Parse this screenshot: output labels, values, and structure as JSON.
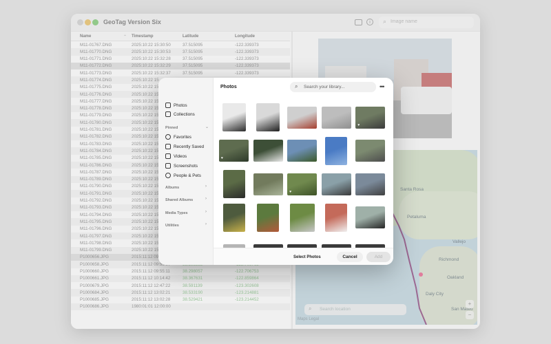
{
  "window": {
    "title": "GeoTag Version Six",
    "search_placeholder": "Image name"
  },
  "table": {
    "headers": [
      "Name",
      "Timestamp",
      "Latitude",
      "Longitude"
    ],
    "rows": [
      [
        "M11-01767.DNG",
        "2025:10:22 15:30:50",
        "37.515095",
        "-122.339373"
      ],
      [
        "M11-01770.DNG",
        "2025:10:22 15:30:53",
        "37.515095",
        "-122.339373"
      ],
      [
        "M11-01771.DNG",
        "2025:10:22 15:32:28",
        "37.515095",
        "-122.339373"
      ],
      [
        "M11-01772.DNG",
        "2025:10:22 15:32:29",
        "37.515095",
        "-122.339373"
      ],
      [
        "M11-01773.DNG",
        "2025:10:22 15:32:37",
        "37.515095",
        "-122.339373"
      ],
      [
        "M11-01774.DNG",
        "2025:10:22 15",
        "",
        ""
      ],
      [
        "M11-01775.DNG",
        "2025:10:22 15",
        "",
        ""
      ],
      [
        "M11-01776.DNG",
        "2025:10:22 15",
        "",
        ""
      ],
      [
        "M11-01777.DNG",
        "2025:10:22 15",
        "",
        ""
      ],
      [
        "M11-01778.DNG",
        "2025:10:22 15",
        "",
        ""
      ],
      [
        "M11-01779.DNG",
        "2025:10:22 15",
        "",
        ""
      ],
      [
        "M11-01780.DNG",
        "2025:10:22 15",
        "",
        ""
      ],
      [
        "M11-01781.DNG",
        "2025:10:22 15",
        "",
        ""
      ],
      [
        "M11-01782.DNG",
        "2025:10:22 15",
        "",
        ""
      ],
      [
        "M11-01783.DNG",
        "2025:10:22 15",
        "",
        ""
      ],
      [
        "M11-01784.DNG",
        "2025:10:22 15",
        "",
        ""
      ],
      [
        "M11-01785.DNG",
        "2025:10:22 15",
        "",
        ""
      ],
      [
        "M11-01786.DNG",
        "2025:10:22 15",
        "",
        ""
      ],
      [
        "M11-01787.DNG",
        "2025:10:22 15",
        "",
        ""
      ],
      [
        "M11-01789.DNG",
        "2025:10:22 15",
        "",
        ""
      ],
      [
        "M11-01790.DNG",
        "2025:10:22 15",
        "",
        ""
      ],
      [
        "M11-01791.DNG",
        "2025:10:22 15",
        "",
        ""
      ],
      [
        "M11-01792.DNG",
        "2025:10:22 15",
        "",
        ""
      ],
      [
        "M11-01793.DNG",
        "2025:10:22 15",
        "",
        ""
      ],
      [
        "M11-01794.DNG",
        "2025:10:22 15",
        "",
        ""
      ],
      [
        "M11-01795.DNG",
        "2025:10:22 15",
        "",
        ""
      ],
      [
        "M11-01796.DNG",
        "2025:10:22 15",
        "",
        ""
      ],
      [
        "M11-01797.DNG",
        "2025:10:22 15",
        "",
        ""
      ],
      [
        "M11-01798.DNG",
        "2025:10:22 15",
        "",
        ""
      ],
      [
        "M11-01799.DNG",
        "2025:10:22 15",
        "",
        ""
      ],
      [
        "P1000656.JPG",
        "2015:11:12 09:52:20",
        "37.765649",
        "-122.475643"
      ],
      [
        "P1000658.JPG",
        "2015:11:12 09:55:07",
        "38.295535",
        "-122.709765"
      ],
      [
        "P1000660.JPG",
        "2015:11:12 09:55:11",
        "38.298057",
        "-122.706753"
      ],
      [
        "P1000661.JPG",
        "2015:11:12 10:14:42",
        "38.367631",
        "-122.859864"
      ],
      [
        "P1000679.JPG",
        "2015:11:12 12:47:22",
        "38.591139",
        "-123.302608"
      ],
      [
        "P1000684.JPG",
        "2015:11:12 13:02:21",
        "38.533190",
        "-123.214881"
      ],
      [
        "P1000685.JPG",
        "2015:11:12 13:02:28",
        "38.529421",
        "-123.214452"
      ],
      [
        "P1000686.JPG",
        "1980:01:01 12:00:00",
        "",
        ""
      ]
    ]
  },
  "map": {
    "labels": [
      "Santa Rosa",
      "Petaluma",
      "Vallejo",
      "Richmond",
      "Oakland",
      "Daly City",
      "San Mateo"
    ],
    "search_placeholder": "Search location",
    "attribution": "Maps",
    "legal": "Legal",
    "zoom_in": "+",
    "zoom_out": "−"
  },
  "picker": {
    "title": "Photos",
    "search_placeholder": "Search your library...",
    "more": "•••",
    "sidebar": {
      "top": [
        {
          "label": "Photos",
          "icon": "photos-icon"
        },
        {
          "label": "Collections",
          "icon": "collections-icon"
        }
      ],
      "pinned_label": "Pinned",
      "pinned": [
        {
          "label": "Favorites",
          "icon": "heart-icon"
        },
        {
          "label": "Recently Saved",
          "icon": "recently-saved-icon"
        },
        {
          "label": "Videos",
          "icon": "video-icon"
        },
        {
          "label": "Screenshots",
          "icon": "screenshot-icon"
        },
        {
          "label": "People & Pets",
          "icon": "people-icon"
        }
      ],
      "sections": [
        "Albums",
        "Shared Albums",
        "Media Types",
        "Utilities"
      ]
    },
    "footer_label": "Select Photos",
    "cancel": "Cancel",
    "add": "Add",
    "favorite_glyph": "♥",
    "thumbs": [
      {
        "colors": [
          "#e9e9e9",
          "#2b2b2b"
        ],
        "fav": false
      },
      {
        "colors": [
          "#d9d9d9",
          "#1f1f1f"
        ],
        "fav": false
      },
      {
        "colors": [
          "#cfcfcf",
          "#a53e2e"
        ],
        "fav": false
      },
      {
        "colors": [
          "#bdbdbd",
          "#8f8f8f"
        ],
        "fav": false
      },
      {
        "colors": [
          "#6f7b62",
          "#3b3b3b"
        ],
        "fav": true
      },
      {
        "colors": [
          "#5e6c4f",
          "#2e3a2a"
        ],
        "fav": true
      },
      {
        "colors": [
          "#3d4f37",
          "#e8e8e8"
        ],
        "fav": false
      },
      {
        "colors": [
          "#6d8fb5",
          "#3c5a2a"
        ],
        "fav": false
      },
      {
        "colors": [
          "#4a7bc4",
          "#8fb3e0"
        ],
        "fav": false
      },
      {
        "colors": [
          "#7c8a70",
          "#4d4d4d"
        ],
        "fav": false
      },
      {
        "colors": [
          "#5b6b46",
          "#2b2b2b"
        ],
        "fav": false
      },
      {
        "colors": [
          "#727b5d",
          "#aab59a"
        ],
        "fav": false
      },
      {
        "colors": [
          "#70894e",
          "#3e5328"
        ],
        "fav": true
      },
      {
        "colors": [
          "#8aa0a8",
          "#3a3a3a"
        ],
        "fav": false
      },
      {
        "colors": [
          "#7b8a9a",
          "#404040"
        ],
        "fav": false
      },
      {
        "colors": [
          "#4e5b3e",
          "#c8b14a"
        ],
        "fav": false
      },
      {
        "colors": [
          "#5c7a3e",
          "#b35a3a"
        ],
        "fav": false
      },
      {
        "colors": [
          "#6d8b44",
          "#c7c7c7"
        ],
        "fav": false
      },
      {
        "colors": [
          "#c46a5a",
          "#f0f0f0"
        ],
        "fav": false
      },
      {
        "colors": [
          "#9fb0a8",
          "#252525"
        ],
        "fav": false
      },
      {
        "colors": [
          "#b5b5b5",
          "#777"
        ],
        "fav": false
      },
      {
        "colors": [
          "#3a3a3a",
          "#555"
        ],
        "fav": false
      },
      {
        "colors": [
          "#3a3a3a",
          "#555"
        ],
        "fav": false
      },
      {
        "colors": [
          "#3a3a3a",
          "#555"
        ],
        "fav": false
      },
      {
        "colors": [
          "#3a3a3a",
          "#555"
        ],
        "fav": false
      }
    ]
  }
}
